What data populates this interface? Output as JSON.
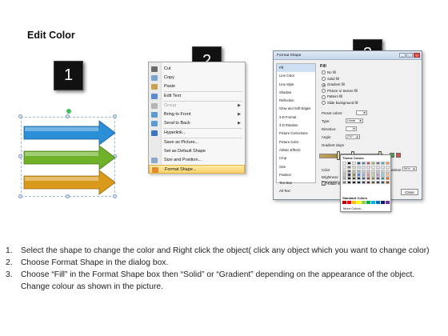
{
  "page": {
    "title": "Edit Color"
  },
  "steps": {
    "one": "1",
    "two": "2",
    "three": "3"
  },
  "arrows": {
    "colors": [
      "#2b8fd8",
      "#6fb22a",
      "#d99a1c"
    ]
  },
  "context_menu": {
    "items": [
      {
        "label": "Cut",
        "icon": "scissors-icon",
        "disabled": false,
        "submenu": false,
        "highlighted": false
      },
      {
        "label": "Copy",
        "icon": "copy-icon",
        "disabled": false,
        "submenu": false,
        "highlighted": false
      },
      {
        "label": "Paste",
        "icon": "paste-icon",
        "disabled": false,
        "submenu": false,
        "highlighted": false
      },
      {
        "label": "Edit Text",
        "icon": "edit-text-icon",
        "disabled": false,
        "submenu": false,
        "highlighted": false
      },
      {
        "label": "Group",
        "icon": "group-icon",
        "disabled": true,
        "submenu": true,
        "highlighted": false
      },
      {
        "label": "Bring to Front",
        "icon": "bring-front-icon",
        "disabled": false,
        "submenu": true,
        "highlighted": false
      },
      {
        "label": "Send to Back",
        "icon": "send-back-icon",
        "disabled": false,
        "submenu": true,
        "highlighted": false
      },
      {
        "label": "Hyperlink...",
        "icon": "hyperlink-icon",
        "disabled": false,
        "submenu": false,
        "highlighted": false
      },
      {
        "label": "Save as Picture...",
        "icon": "",
        "disabled": false,
        "submenu": false,
        "highlighted": false
      },
      {
        "label": "Set as Default Shape",
        "icon": "",
        "disabled": false,
        "submenu": false,
        "highlighted": false
      },
      {
        "label": "Size and Position...",
        "icon": "size-position-icon",
        "disabled": false,
        "submenu": false,
        "highlighted": false
      },
      {
        "label": "Format Shape...",
        "icon": "format-shape-icon",
        "disabled": false,
        "submenu": false,
        "highlighted": true
      }
    ]
  },
  "dialog": {
    "title": "Format Shape",
    "controls": {
      "minimize": "–",
      "maximize": "□",
      "close": "×"
    },
    "nav": [
      "Fill",
      "Line Color",
      "Line Style",
      "Shadow",
      "Reflection",
      "Glow and Soft Edges",
      "3-D Format",
      "3-D Rotation",
      "Picture Corrections",
      "Picture Color",
      "Artistic Effects",
      "Crop",
      "Size",
      "Position",
      "Text Box",
      "Alt Text"
    ],
    "section_title": "Fill",
    "fill_options": [
      {
        "label": "No fill",
        "selected": false
      },
      {
        "label": "Solid fill",
        "selected": false
      },
      {
        "label": "Gradient fill",
        "selected": true
      },
      {
        "label": "Picture or texture fill",
        "selected": false
      },
      {
        "label": "Pattern fill",
        "selected": false
      },
      {
        "label": "Slide background fill",
        "selected": false
      }
    ],
    "labels": {
      "preset": "Preset colors:",
      "type": "Type:",
      "type_value": "Linear",
      "direction": "Direction:",
      "angle": "Angle:",
      "angle_value": "270°",
      "gradient_stops": "Gradient stops",
      "color": "Color",
      "position": "Position:",
      "position_value": "50%",
      "brightness": "Brightness:",
      "transparency": "Transparency:",
      "rotate": "Rotate with shape",
      "close": "Close"
    },
    "gradient_colors": [
      "#c6a55a",
      "#8c7233"
    ]
  },
  "palette": {
    "theme_title": "Theme Colors",
    "standard_title": "Standard Colors",
    "more": "More Colors...",
    "theme_rows": [
      [
        "#ffffff",
        "#000000",
        "#eeece1",
        "#1f497d",
        "#4f81bd",
        "#c0504d",
        "#9bbb59",
        "#8064a2",
        "#4bacc6",
        "#f79646"
      ],
      [
        "#f2f2f2",
        "#7f7f7f",
        "#ddd9c3",
        "#c6d9f0",
        "#dbe5f1",
        "#f2dcdb",
        "#ebf1dd",
        "#e5e0ec",
        "#dbeef3",
        "#fdeada"
      ],
      [
        "#d8d8d8",
        "#595959",
        "#c4bd97",
        "#8db3e2",
        "#b8cce4",
        "#e5b9b7",
        "#d7e3bc",
        "#ccc1d9",
        "#b7dde8",
        "#fbd5b5"
      ],
      [
        "#bfbfbf",
        "#3f3f3f",
        "#938953",
        "#548dd4",
        "#95b3d7",
        "#d99694",
        "#c3d69b",
        "#b2a2c7",
        "#92cddc",
        "#fac08f"
      ],
      [
        "#a5a5a5",
        "#262626",
        "#494429",
        "#17365d",
        "#366092",
        "#953734",
        "#76923c",
        "#5f497a",
        "#31859b",
        "#e36c09"
      ],
      [
        "#7f7f7f",
        "#0c0c0c",
        "#1d1b10",
        "#0f243e",
        "#244061",
        "#632423",
        "#4f6128",
        "#3f3151",
        "#205867",
        "#974806"
      ]
    ],
    "standard": [
      "#c00000",
      "#ff0000",
      "#ffc000",
      "#ffff00",
      "#92d050",
      "#00b050",
      "#00b0f0",
      "#0070c0",
      "#002060",
      "#7030a0"
    ]
  },
  "instructions": [
    {
      "num": "1.",
      "text": "Select the shape to change the color and Right click the object( click any object which you want to change color)"
    },
    {
      "num": "2.",
      "text": "Choose Format Shape in the dialog box."
    },
    {
      "num": "3.",
      "text": "Choose “Fill” in the Format Shape box then “Solid” or “Gradient” depending on the appearance of the object. Change colour as shown in the picture."
    }
  ]
}
